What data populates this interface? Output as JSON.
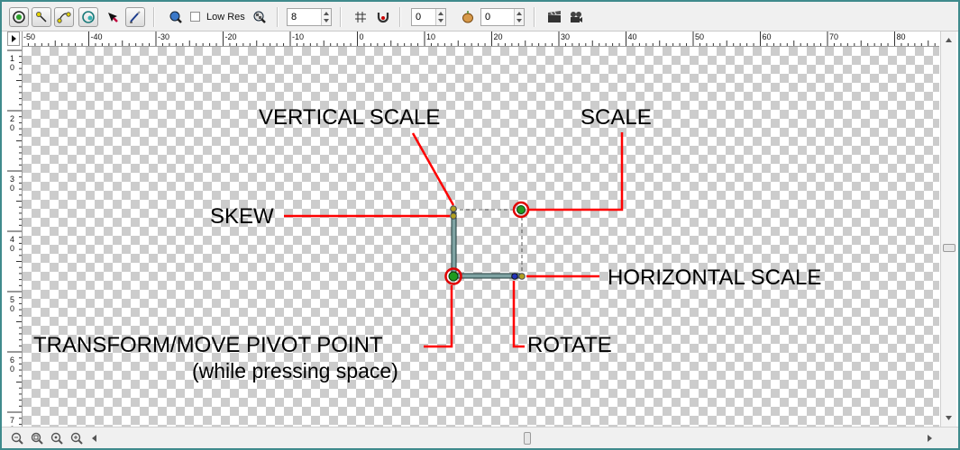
{
  "toolbar": {
    "tools": [
      {
        "name": "select-icon",
        "active": true
      },
      {
        "name": "point-edit-icon",
        "active": false
      },
      {
        "name": "curve-edit-icon",
        "active": false
      },
      {
        "name": "transform-icon",
        "active": false
      },
      {
        "name": "color-pick-icon",
        "active": false
      },
      {
        "name": "pen-icon",
        "active": false
      }
    ],
    "low_res_label": "Low Res",
    "low_res_checked": false,
    "size_value": "8",
    "offset_x_value": "0",
    "offset_y_value": "0"
  },
  "ruler": {
    "h_labels": [
      "-50",
      "-40",
      "-30",
      "-20",
      "-10",
      "0",
      "10",
      "20",
      "30",
      "40",
      "50",
      "60",
      "70",
      "80"
    ],
    "v_labels": [
      "1",
      "2",
      "3",
      "4",
      "5",
      "6",
      "7"
    ]
  },
  "annotations": {
    "vertical_scale": "VERTICAL SCALE",
    "scale": "SCALE",
    "skew": "SKEW",
    "horizontal_scale": "HORIZONTAL SCALE",
    "pivot_line1": "TRANSFORM/MOVE PIVOT POINT",
    "pivot_line2": "(while pressing space)",
    "rotate": "ROTATE"
  },
  "colors": {
    "annotation_line": "#ff0000",
    "handle_green": "#1f9a1f",
    "handle_ring": "#e00000",
    "frame_border": "#3f8a8c"
  }
}
